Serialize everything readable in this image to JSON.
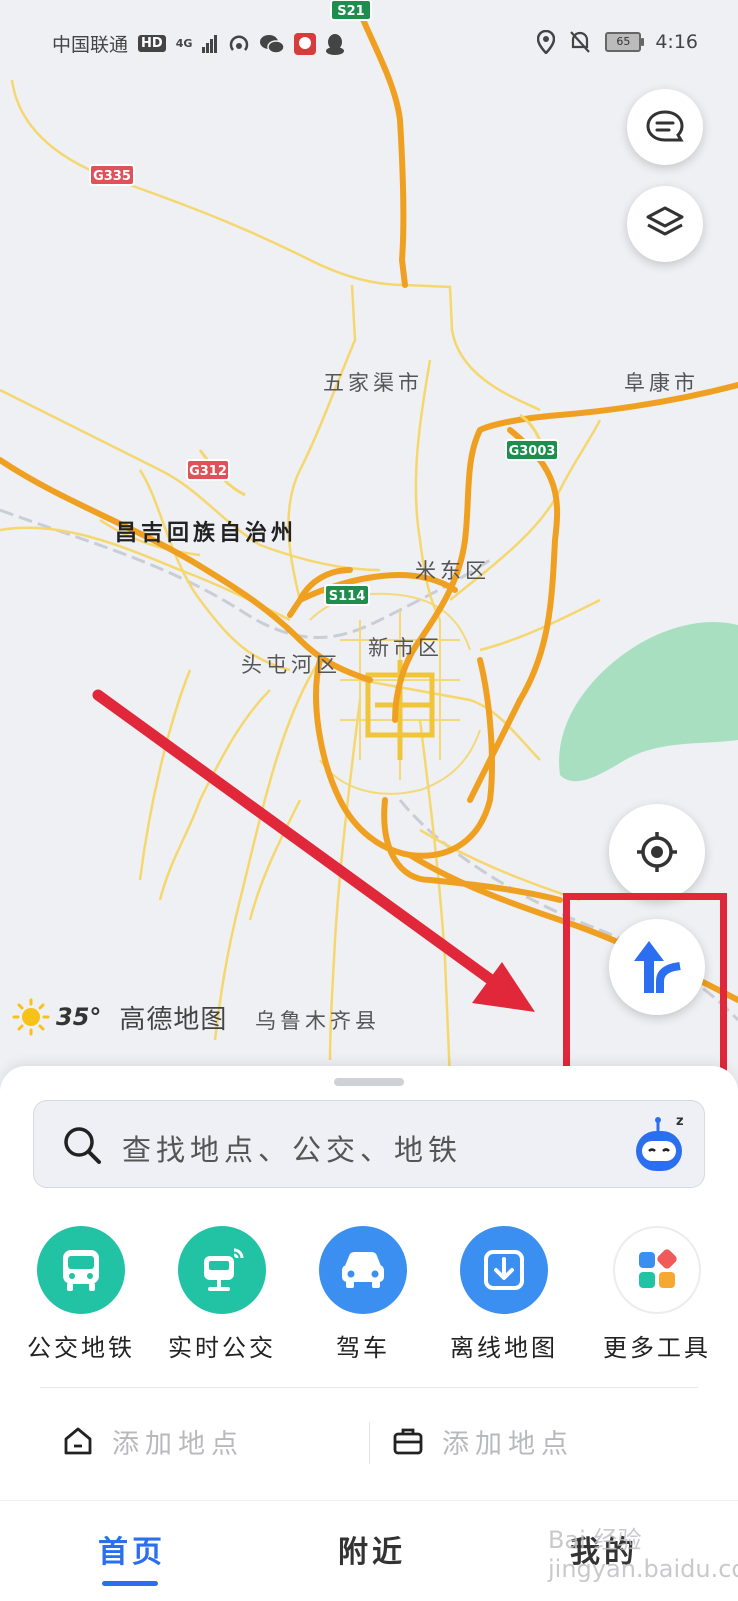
{
  "status_bar": {
    "carrier": "中国联通",
    "hd_badge": "HD",
    "network": "4G",
    "battery": "65",
    "time": "4:16"
  },
  "map": {
    "place_labels": [
      "五家渠市",
      "阜康市",
      "昌吉回族自治州",
      "米东区",
      "新市区",
      "头屯河区",
      "乌鲁木齐县"
    ],
    "road_shields": [
      "S21",
      "G335",
      "G312",
      "G3003",
      "S114"
    ],
    "colors": {
      "water": "#a8dfc0",
      "highway": "#f0a020",
      "road": "#f5d76e",
      "railway": "#c8cdd6"
    }
  },
  "weather": {
    "icon": "sun-icon",
    "temperature": "35°",
    "brand": "高德地图"
  },
  "annotation": {
    "arrow_color": "#e0283a",
    "box_color": "#e0283a"
  },
  "search": {
    "placeholder": "查找地点、公交、地铁"
  },
  "quick_actions": [
    {
      "label": "公交地铁",
      "icon": "bus-icon",
      "color": "#22c3a4"
    },
    {
      "label": "实时公交",
      "icon": "realtime-bus-icon",
      "color": "#22c3a4"
    },
    {
      "label": "驾车",
      "icon": "car-icon",
      "color": "#3a8ff0"
    },
    {
      "label": "离线地图",
      "icon": "offline-download-icon",
      "color": "#3a8ff0"
    },
    {
      "label": "更多工具",
      "icon": "grid-tools-icon",
      "color": "#ffffff"
    }
  ],
  "places": [
    {
      "icon": "home-icon",
      "label": "添加地点"
    },
    {
      "icon": "briefcase-icon",
      "label": "添加地点"
    }
  ],
  "tabs": [
    {
      "label": "首页",
      "active": true
    },
    {
      "label": "附近",
      "active": false
    },
    {
      "label": "我的",
      "active": false
    }
  ],
  "watermark": "Bai 经验 jingyan.baidu.com"
}
